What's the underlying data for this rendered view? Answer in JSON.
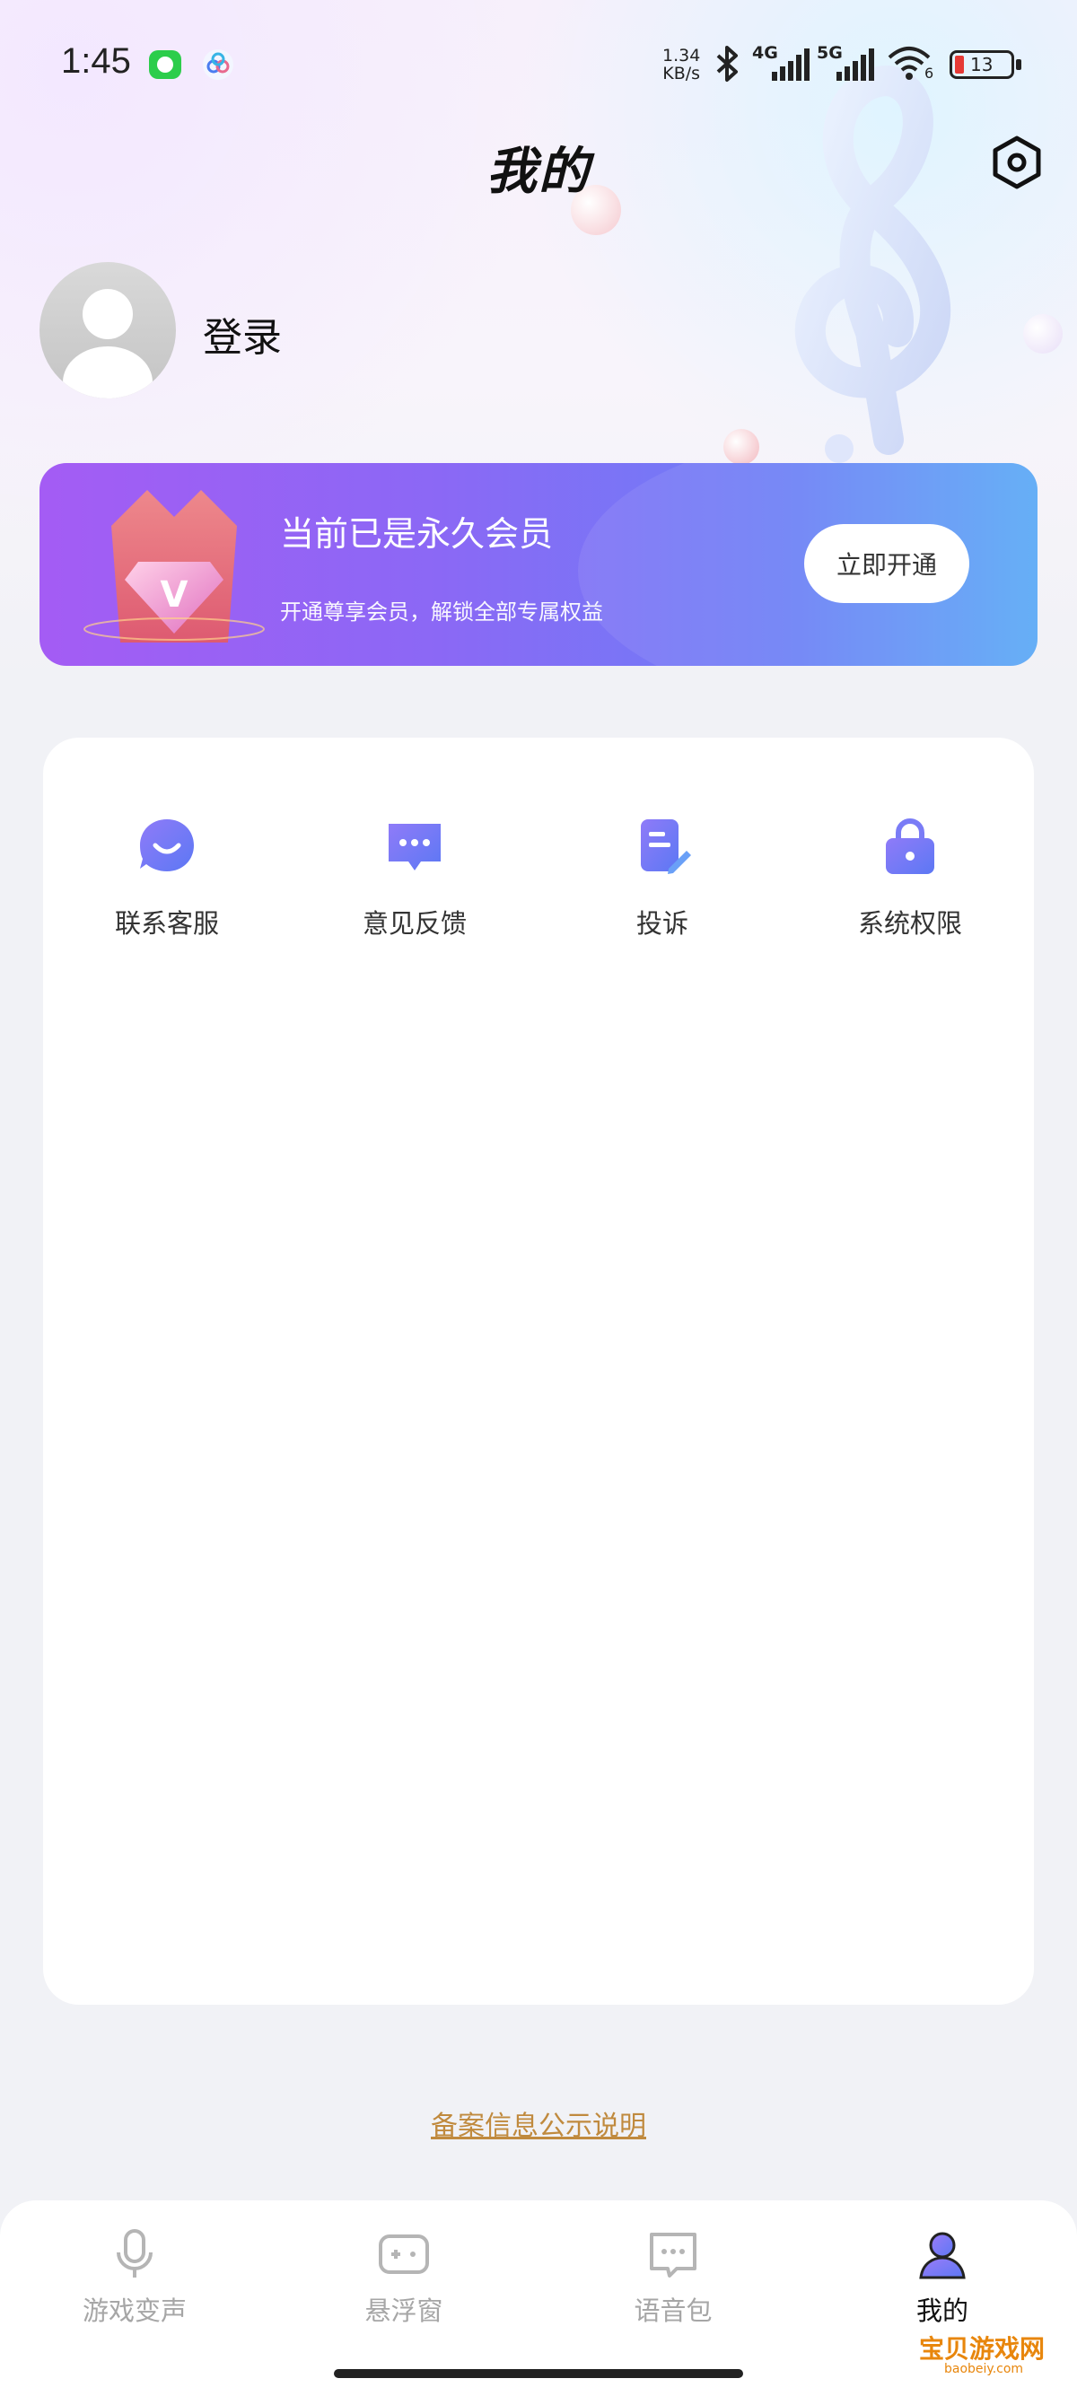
{
  "status_bar": {
    "time": "1:45",
    "net_speed_value": "1.34",
    "net_speed_unit": "KB/s",
    "signal_1": "4G",
    "signal_2": "5G",
    "wifi_badge": "6",
    "battery": "13"
  },
  "header": {
    "title": "我的",
    "settings_icon": "settings-hexagon-icon"
  },
  "profile": {
    "login_label": "登录"
  },
  "vip": {
    "title": "当前已是永久会员",
    "subtitle": "开通尊享会员，解锁全部专属权益",
    "button": "立即开通",
    "badge_letter": "V"
  },
  "menu": {
    "items": [
      {
        "label": "联系客服",
        "icon": "customer-service-icon"
      },
      {
        "label": "意见反馈",
        "icon": "feedback-icon"
      },
      {
        "label": "投诉",
        "icon": "complaint-icon"
      },
      {
        "label": "系统权限",
        "icon": "lock-icon"
      }
    ]
  },
  "footer": {
    "beian_link": "备案信息公示说明"
  },
  "tabbar": {
    "items": [
      {
        "label": "游戏变声",
        "icon": "microphone-icon",
        "active": false
      },
      {
        "label": "悬浮窗",
        "icon": "gamepad-icon",
        "active": false
      },
      {
        "label": "语音包",
        "icon": "chat-icon",
        "active": false
      },
      {
        "label": "我的",
        "icon": "user-icon",
        "active": true
      }
    ]
  },
  "watermark": {
    "text": "宝贝游戏网",
    "sub": "baobeiy.com"
  },
  "colors": {
    "accent": "#7b6cf6",
    "vip_gradient_start": "#a45cf4",
    "vip_gradient_end": "#5aa9f6",
    "link": "#c08a3e"
  }
}
